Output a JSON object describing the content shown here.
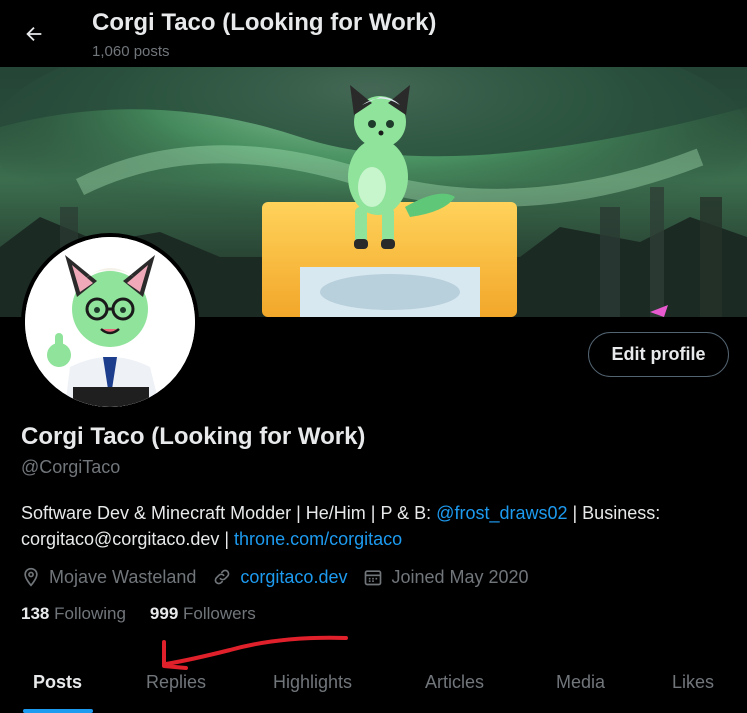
{
  "header": {
    "title": "Corgi Taco (Looking for Work)",
    "post_count": "1,060 posts"
  },
  "profile": {
    "display_name": "Corgi Taco (Looking for Work)",
    "handle": "@CorgiTaco",
    "edit_button": "Edit profile",
    "bio": {
      "part1": "Software Dev & Minecraft Modder | He/Him | P & B: ",
      "mention": "@frost_draws02",
      "part2": " | Business: corgitaco@corgitaco.dev | ",
      "link": "throne.com/corgitaco"
    },
    "location": "Mojave Wasteland",
    "website": "corgitaco.dev",
    "joined": "Joined May 2020",
    "following_count": "138",
    "following_label": "Following",
    "followers_count": "999",
    "followers_label": "Followers"
  },
  "tabs": [
    {
      "label": "Posts",
      "active": true
    },
    {
      "label": "Replies"
    },
    {
      "label": "Highlights"
    },
    {
      "label": "Articles"
    },
    {
      "label": "Media"
    },
    {
      "label": "Likes"
    }
  ],
  "colors": {
    "accent": "#1d9bf0",
    "secondary_text": "#71767b",
    "annotation_arrow": "#e0202a"
  }
}
